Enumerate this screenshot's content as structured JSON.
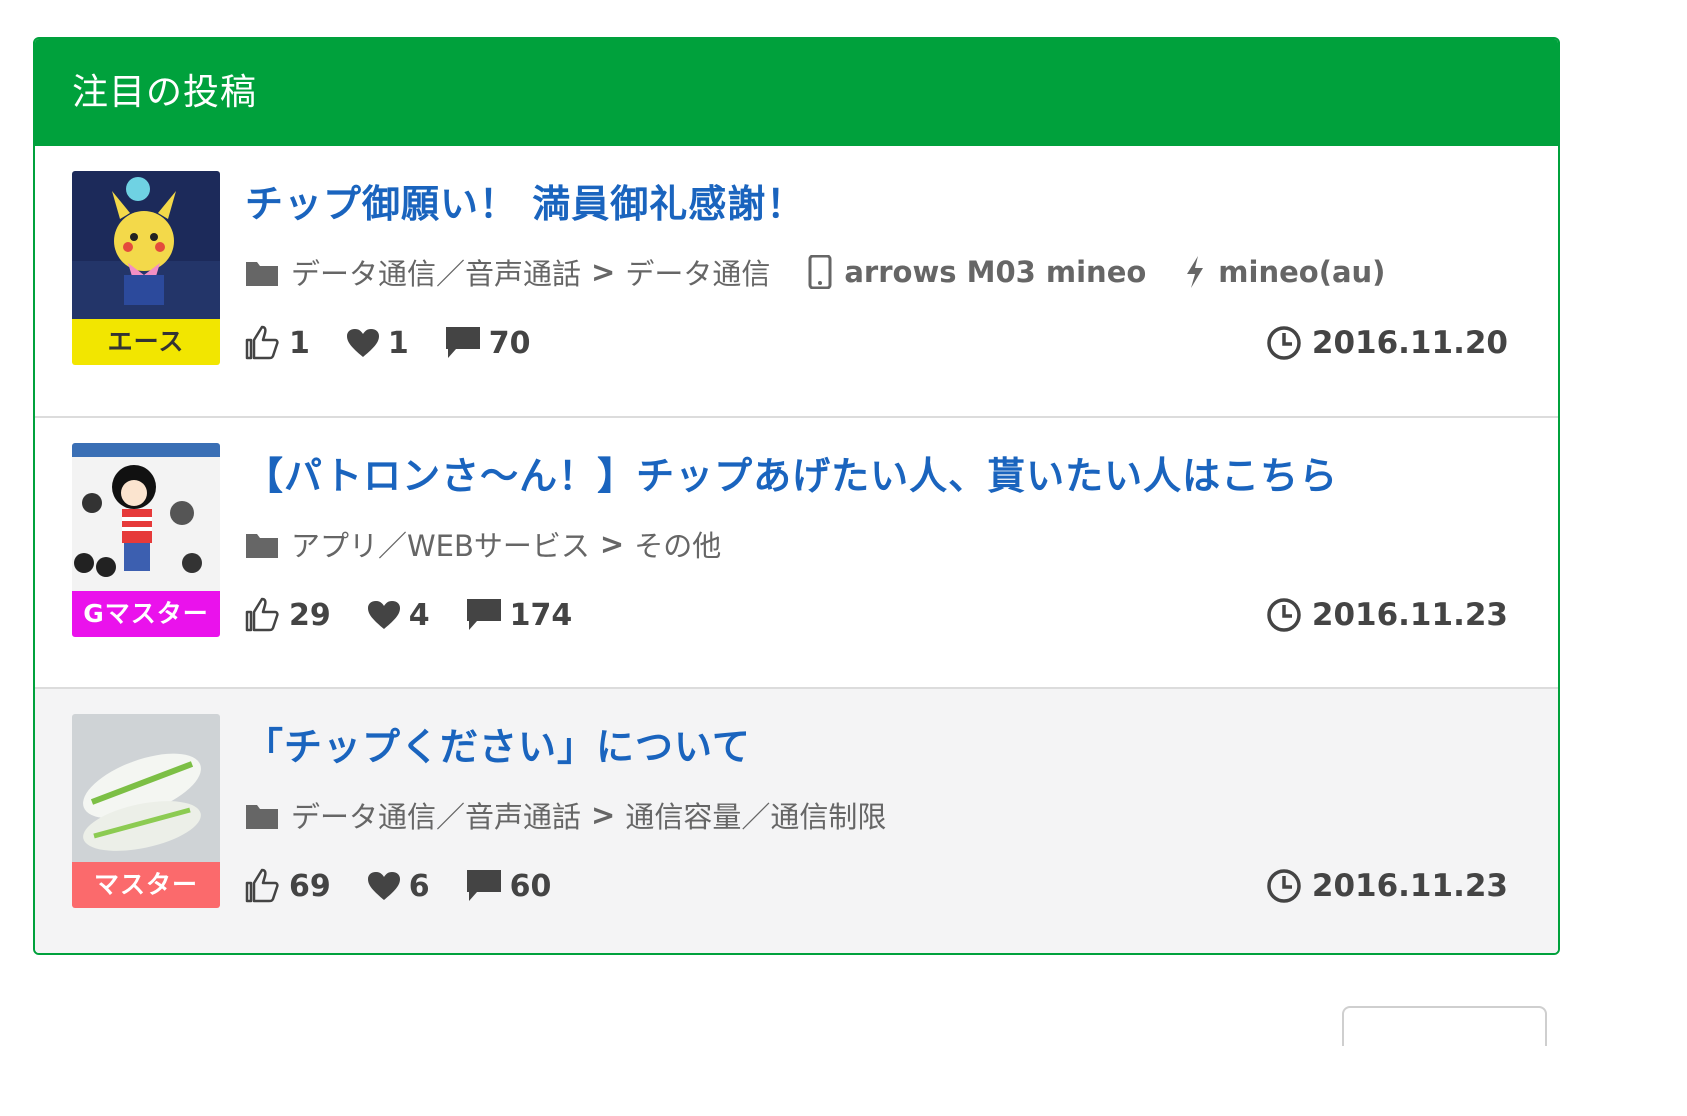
{
  "panel": {
    "header_title": "注目の投稿"
  },
  "colors": {
    "header_bg": "#00a13c",
    "title_link": "#1a64be",
    "badge_ace": "#f2e600",
    "badge_gmaster": "#ea12ec",
    "badge_master": "#fb6a6c"
  },
  "posts": [
    {
      "title": "チップ御願い！ 満員御礼感謝！",
      "badge": "エース",
      "category": "データ通信／音声通話",
      "separator": ">",
      "subcategory": "データ通信",
      "device": "arrows M03 mineo",
      "carrier": "mineo(au)",
      "thanks": "1",
      "likes": "1",
      "comments": "70",
      "date": "2016.11.20"
    },
    {
      "title": "【パトロンさ〜ん！】チップあげたい人、貰いたい人はこちら",
      "badge": "Gマスター",
      "category": "アプリ／WEBサービス",
      "separator": ">",
      "subcategory": "その他",
      "thanks": "29",
      "likes": "4",
      "comments": "174",
      "date": "2016.11.23"
    },
    {
      "title": "「チップください」について",
      "badge": "マスター",
      "category": "データ通信／音声通話",
      "separator": ">",
      "subcategory": "通信容量／通信制限",
      "thanks": "69",
      "likes": "6",
      "comments": "60",
      "date": "2016.11.23"
    }
  ],
  "icons": {
    "folder": "folder-icon",
    "phone": "phone-icon",
    "bolt": "lightning-icon",
    "thumbs_up": "thumbs-up-icon",
    "heart": "heart-icon",
    "comment": "comment-icon",
    "clock": "clock-icon"
  }
}
